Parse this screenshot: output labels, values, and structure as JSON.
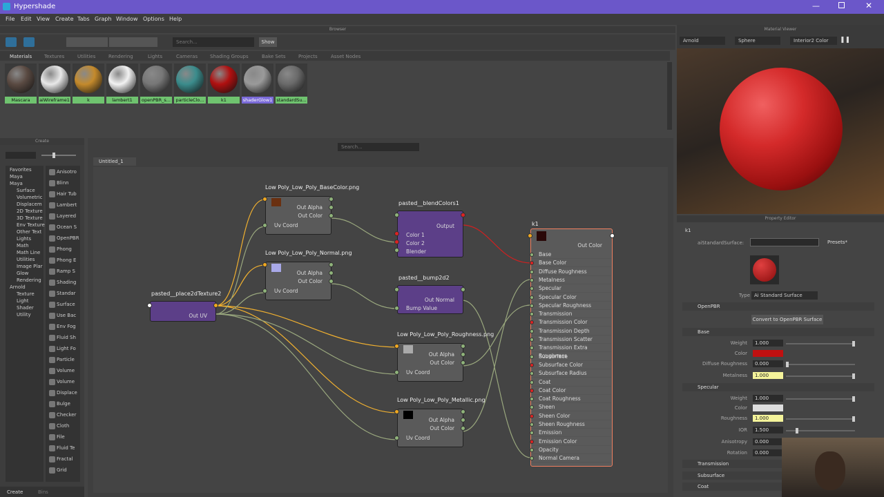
{
  "window": {
    "title": "Hypershade"
  },
  "menu": [
    "File",
    "Edit",
    "View",
    "Create",
    "Tabs",
    "Graph",
    "Window",
    "Options",
    "Help"
  ],
  "browser": {
    "title": "Browser",
    "search_placeholder": "Search...",
    "show_label": "Show",
    "tabs": [
      "Materials",
      "Textures",
      "Utilities",
      "Rendering",
      "Lights",
      "Cameras",
      "Shading Groups",
      "Bake Sets",
      "Projects",
      "Asset Nodes"
    ],
    "materials": [
      {
        "label": "Mascara",
        "color": "#5a4a42"
      },
      {
        "label": "aiWireframe1",
        "color": "#e8e8e8"
      },
      {
        "label": "k",
        "color": "#c48a2c"
      },
      {
        "label": "lambert1",
        "color": "#f2f2f2"
      },
      {
        "label": "openPBR_s...",
        "color": "#777777"
      },
      {
        "label": "particleClo...",
        "color": "#3b8c8c"
      },
      {
        "label": "k1",
        "color": "#b01010"
      },
      {
        "label": "shaderGlow1",
        "color": "#9a9a9a"
      },
      {
        "label": "standardSu...",
        "color": "#6a6a6a"
      }
    ],
    "selected_material": "shaderGlow1"
  },
  "create": {
    "title": "Create",
    "categories": [
      "Favorites",
      "Maya",
      "Maya",
      "Surface",
      "Volumetric",
      "Displacem",
      "2D Texture",
      "3D Texture",
      "Env Texture",
      "Other Text",
      "Lights",
      "Math",
      "Math Line",
      "Utilities",
      "Image Plar",
      "Glow",
      "Rendering",
      "Arnold",
      "Texture",
      "Light",
      "Shader",
      "Utility"
    ],
    "items": [
      "Anisotro",
      "Blinn",
      "Hair Tub",
      "Lambert",
      "Layered",
      "Ocean S",
      "OpenPBR",
      "Phong",
      "Phong E",
      "Ramp S",
      "Shading",
      "Standar",
      "Surface",
      "Use Bac",
      "Env Fog",
      "Fluid Sh",
      "Light Fo",
      "Particle",
      "Volume",
      "Volume",
      "Displace",
      "Bulge",
      "Checker",
      "Cloth",
      "File",
      "Fluid Te",
      "Fractal",
      "Grid"
    ],
    "bottom_tabs": [
      "Create",
      "Bins"
    ]
  },
  "graph": {
    "tab": "Untitled_1",
    "search_placeholder": "Search...",
    "nodes": {
      "base": {
        "title": "Low Poly_Low_Poly_BaseColor.png",
        "out_alpha": "Out Alpha",
        "out_color": "Out Color",
        "uv": "Uv Coord"
      },
      "normal": {
        "title": "Low Poly_Low_Poly_Normal.png",
        "out_alpha": "Out Alpha",
        "out_color": "Out Color",
        "uv": "Uv Coord"
      },
      "place": {
        "title": "pasted__place2dTexture2",
        "out_uv": "Out UV"
      },
      "blend": {
        "title": "pasted__blendColors1",
        "output": "Output",
        "c1": "Color 1",
        "c2": "Color 2",
        "blender": "Blender"
      },
      "bump": {
        "title": "pasted__bump2d2",
        "out_normal": "Out Normal",
        "bump_value": "Bump Value"
      },
      "rough": {
        "title": "Low Poly_Low_Poly_Roughness.png",
        "out_alpha": "Out Alpha",
        "out_color": "Out Color",
        "uv": "Uv Coord"
      },
      "metal": {
        "title": "Low Poly_Low_Poly_Metallic.png",
        "out_alpha": "Out Alpha",
        "out_color": "Out Color",
        "uv": "Uv Coord"
      },
      "k1": {
        "title": "k1",
        "out_color": "Out Color",
        "attrs": [
          "Base",
          "Base Color",
          "Diffuse Roughness",
          "Metalness",
          "Specular",
          "Specular Color",
          "Specular Roughness",
          "Transmission",
          "Transmission Color",
          "Transmission Depth",
          "Transmission Scatter",
          "Transmission Extra Roughness",
          "Subsurface",
          "Subsurface Color",
          "Subsurface Radius",
          "Coat",
          "Coat Color",
          "Coat Roughness",
          "Sheen",
          "Sheen Color",
          "Sheen Roughness",
          "Emission",
          "Emission Color",
          "Opacity",
          "Normal Camera"
        ],
        "connected": [
          1,
          2,
          3,
          5,
          6,
          8,
          10,
          13,
          16,
          19,
          22
        ]
      }
    }
  },
  "viewer": {
    "title": "Material Viewer",
    "renderer": "Arnold",
    "shape": "Sphere",
    "env": "Interior2 Color"
  },
  "property": {
    "title": "Property Editor",
    "node": "k1",
    "type_label": "aiStandardSurface:",
    "presets": "Presets*",
    "type_row": "Type",
    "type_value": "Ai Standard Surface",
    "openpbr": "OpenPBR",
    "convert_label": "Convert to OpenPBR Surface",
    "base": {
      "section": "Base",
      "weight_l": "Weight",
      "weight": "1.000",
      "color_l": "Color",
      "diff_l": "Diffuse Roughness",
      "diff": "0.000",
      "metal_l": "Metalness",
      "metal": "1.000",
      "color_hex": "#c01010"
    },
    "specular": {
      "section": "Specular",
      "weight_l": "Weight",
      "weight": "1.000",
      "color_l": "Color",
      "rough_l": "Roughness",
      "rough": "1.000",
      "ior_l": "IOR",
      "ior": "1.500",
      "aniso_l": "Anisotropy",
      "aniso": "0.000",
      "rot_l": "Rotation",
      "rot": "0.000"
    },
    "sections": [
      "Transmission",
      "Subsurface",
      "Coat"
    ]
  }
}
